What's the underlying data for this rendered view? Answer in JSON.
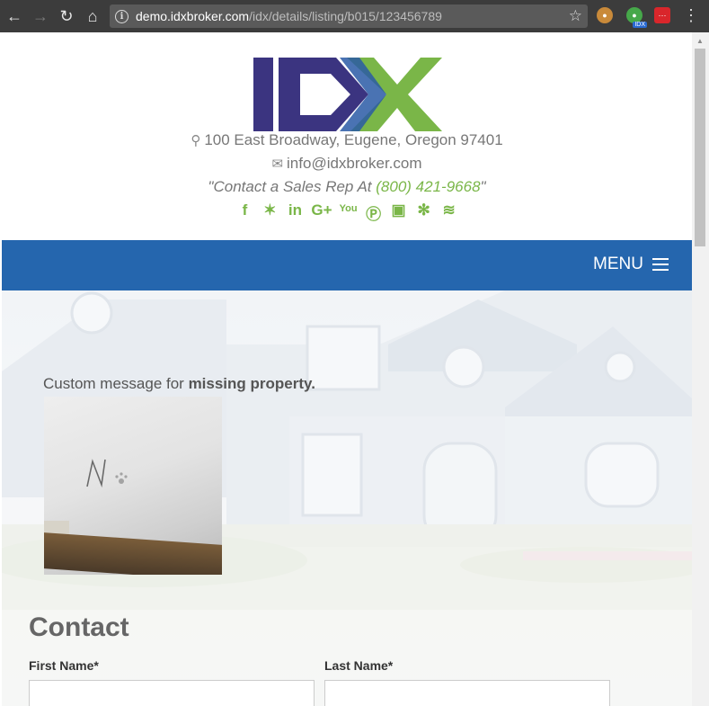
{
  "browser": {
    "url_host": "demo.idxbroker.com",
    "url_path": "/idx/details/listing/b015/123456789",
    "icons": [
      "back-icon",
      "forward-icon",
      "reload-icon",
      "home-icon",
      "info-icon",
      "star-icon",
      "menu-kebab-icon"
    ],
    "extensions": {
      "idx_badge": "IDX"
    }
  },
  "header": {
    "logo_text": "IDX",
    "address": "100 East Broadway, Eugene, Oregon 97401",
    "email": "info@idxbroker.com",
    "sales_prefix": "\"Contact a Sales Rep At ",
    "sales_phone": "(800) 421-9668",
    "sales_suffix": "\"",
    "social_icons": [
      "facebook-icon",
      "twitter-icon",
      "linkedin-icon",
      "google-plus-icon",
      "youtube-icon",
      "pinterest-icon",
      "instagram-icon",
      "yelp-icon",
      "rss-icon"
    ]
  },
  "nav": {
    "menu_label": "MENU"
  },
  "main": {
    "message_prefix": "Custom message for ",
    "message_bold": "missing property."
  },
  "contact": {
    "title": "Contact",
    "first_name_label": "First Name*",
    "last_name_label": "Last Name*"
  },
  "colors": {
    "brand_blue": "#2566ae",
    "brand_green": "#7ab648",
    "logo_purple": "#3b3480"
  }
}
